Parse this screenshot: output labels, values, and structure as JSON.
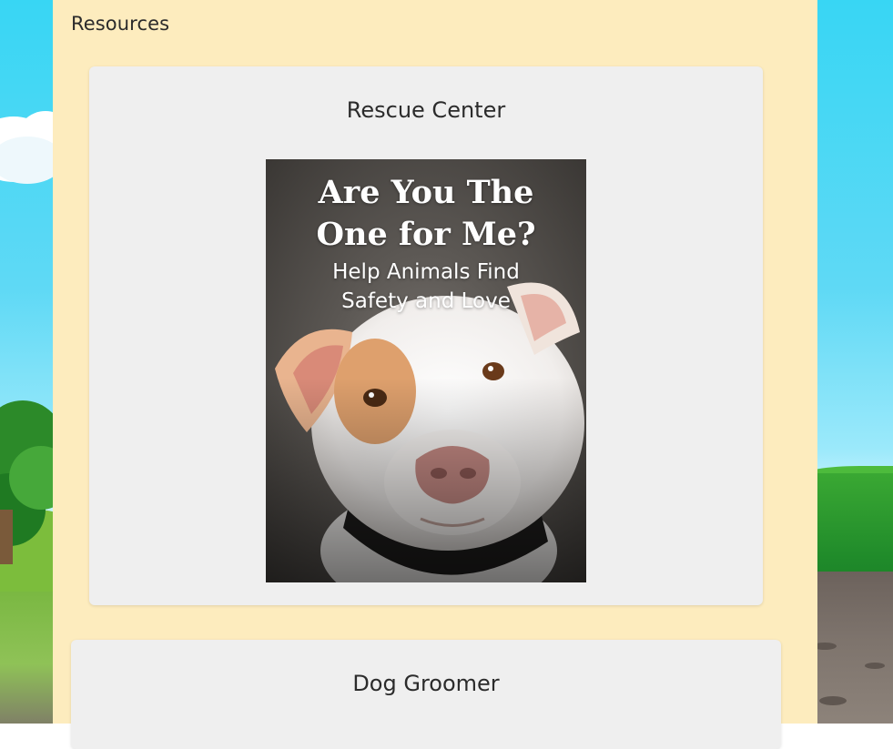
{
  "resources": {
    "heading": "Resources",
    "cards": [
      {
        "title": "Rescue Center",
        "image": {
          "headline_line1": "Are You The",
          "headline_line2": "One for Me?",
          "sub_line1": "Help Animals Find",
          "sub_line2": "Safety and Love"
        }
      },
      {
        "title": "Dog Groomer"
      }
    ]
  },
  "colors": {
    "panel_background": "#fdecbe",
    "card_background": "#efefef",
    "sky": "#38d6f4",
    "text": "#2b2b2b"
  }
}
